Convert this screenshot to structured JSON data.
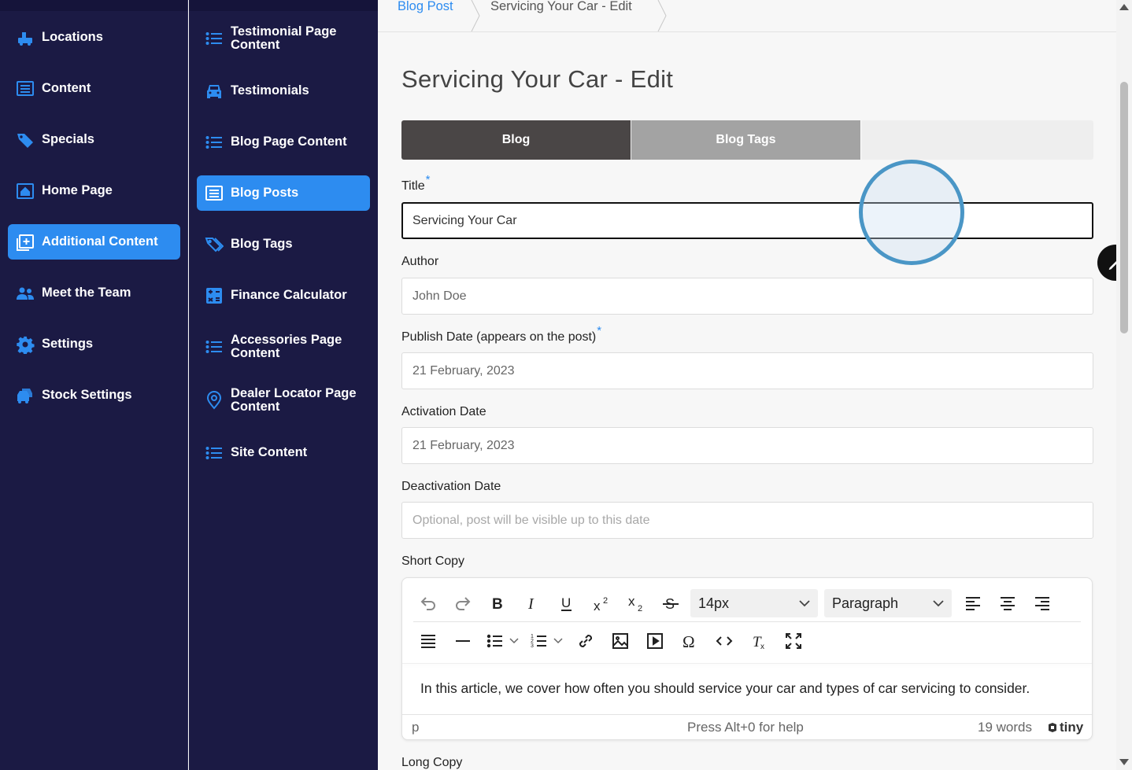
{
  "sidebar_primary": {
    "items": [
      {
        "label": "Locations",
        "icon": "truck-icon"
      },
      {
        "label": "Content",
        "icon": "list-box-icon"
      },
      {
        "label": "Specials",
        "icon": "tag-icon"
      },
      {
        "label": "Home Page",
        "icon": "home-icon"
      },
      {
        "label": "Additional Content",
        "icon": "plus-box-icon",
        "active": true
      },
      {
        "label": "Meet the Team",
        "icon": "people-icon"
      },
      {
        "label": "Settings",
        "icon": "gear-icon"
      },
      {
        "label": "Stock Settings",
        "icon": "cars-icon"
      }
    ]
  },
  "sidebar_secondary": {
    "items": [
      {
        "label": "Testimonial Page Content",
        "icon": "list-icon"
      },
      {
        "label": "Testimonials",
        "icon": "car-front-icon"
      },
      {
        "label": "Blog Page Content",
        "icon": "list-icon"
      },
      {
        "label": "Blog Posts",
        "icon": "newspaper-icon",
        "active": true
      },
      {
        "label": "Blog Tags",
        "icon": "tags-icon"
      },
      {
        "label": "Finance Calculator",
        "icon": "calculator-icon"
      },
      {
        "label": "Accessories Page Content",
        "icon": "list-icon"
      },
      {
        "label": "Dealer Locator Page Content",
        "icon": "map-pin-icon"
      },
      {
        "label": "Site Content",
        "icon": "list-icon"
      }
    ]
  },
  "breadcrumb": {
    "parent": "Blog Post",
    "current": "Servicing Your Car - Edit"
  },
  "page_title": "Servicing Your Car - Edit",
  "tabs": [
    {
      "label": "Blog",
      "active": true
    },
    {
      "label": "Blog Tags",
      "active": false
    }
  ],
  "form": {
    "title": {
      "label": "Title",
      "value": "Servicing Your Car",
      "required": "*"
    },
    "author": {
      "label": "Author",
      "value": "John Doe"
    },
    "publish_date": {
      "label": "Publish Date (appears on the post)",
      "value": "21 February, 2023",
      "required": "*"
    },
    "activation_date": {
      "label": "Activation Date",
      "value": "21 February, 2023"
    },
    "deactivation_date": {
      "label": "Deactivation Date",
      "placeholder": "Optional, post will be visible up to this date"
    },
    "short_copy": {
      "label": "Short Copy",
      "font_size": "14px",
      "block_format": "Paragraph",
      "content": "In this article, we cover how often you should service your car and types of car servicing to consider.",
      "status_path": "p",
      "status_help": "Press Alt+0 for help",
      "word_count": "19 words",
      "brand": "tiny"
    },
    "long_copy": {
      "label": "Long Copy"
    }
  },
  "colors": {
    "sidebar_bg": "#1b1a44",
    "accent": "#2d8cf0",
    "tab_active": "#4a4646",
    "tab_inactive": "#a3a3a3"
  }
}
